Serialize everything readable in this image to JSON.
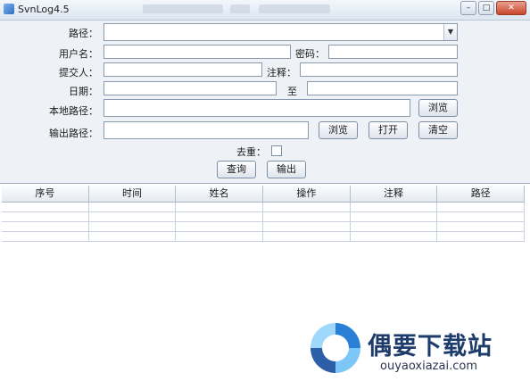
{
  "window": {
    "title": "SvnLog4.5",
    "controls": {
      "minimize": "–",
      "restore": "□",
      "close": "✕"
    }
  },
  "form": {
    "path_label": "路径：",
    "username_label": "用户名：",
    "password_label": "密码：",
    "committer_label": "提交人：",
    "comment_label": "注释：",
    "date_label": "日期：",
    "date_to_label": "至",
    "local_path_label": "本地路径：",
    "output_path_label": "输出路径：",
    "dedup_label": "去重：",
    "browse_local": "浏览",
    "browse_output": "浏览",
    "open": "打开",
    "clear": "清空",
    "query": "查询",
    "export": "输出"
  },
  "table": {
    "columns": [
      "序号",
      "时间",
      "姓名",
      "操作",
      "注释",
      "路径"
    ]
  },
  "watermark": {
    "title": "偶要下载站",
    "subtitle": "ouyaoxiazai.com"
  }
}
